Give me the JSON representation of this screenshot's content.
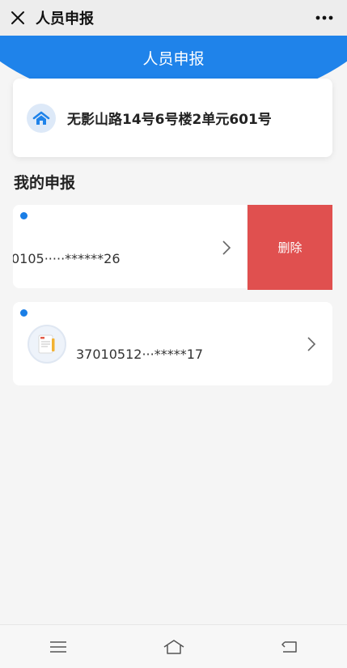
{
  "topbar": {
    "title": "人员申报"
  },
  "header": {
    "title": "人员申报"
  },
  "address": {
    "text": "无影山路14号6号楼2单元601号"
  },
  "section": {
    "title": "我的申报"
  },
  "items": [
    {
      "id_number": "0105·····******26",
      "delete_label": "删除"
    },
    {
      "id_number": "37010512···*****17"
    }
  ],
  "colors": {
    "accent": "#1f83ea",
    "delete": "#e0504f",
    "dot": "#1a7ee6"
  },
  "icons": [
    "close-icon",
    "more-icon",
    "house-icon",
    "chevron-right-icon",
    "document-icon",
    "menu-icon",
    "home-icon",
    "back-icon"
  ]
}
